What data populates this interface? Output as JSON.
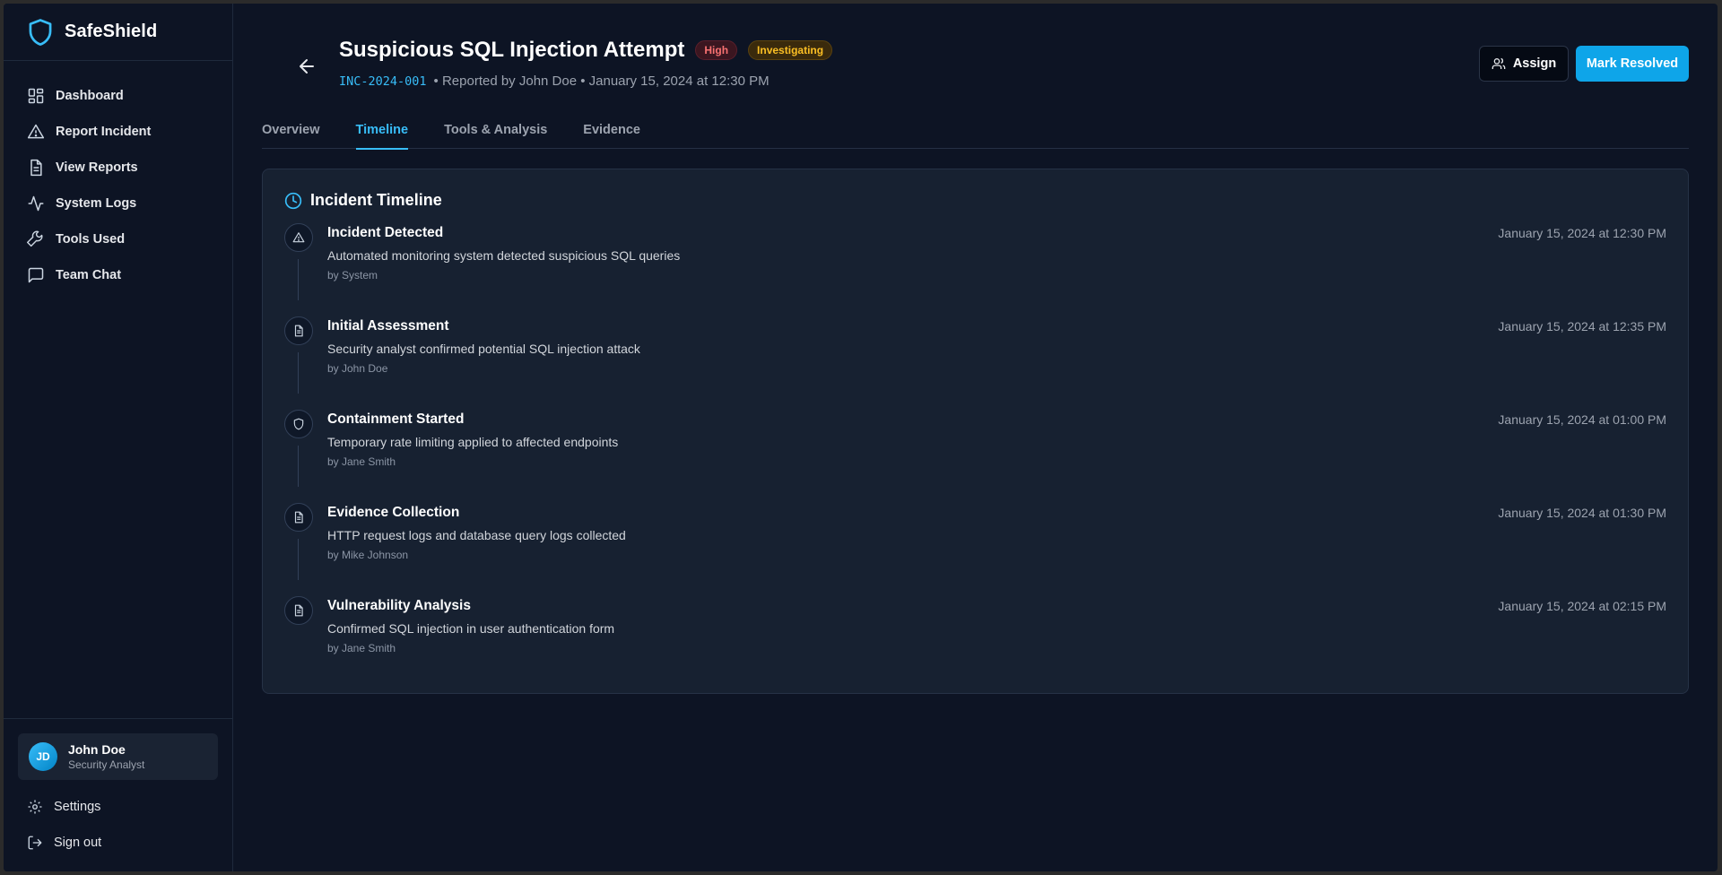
{
  "brand": {
    "name": "SafeShield"
  },
  "nav": [
    {
      "label": "Dashboard",
      "icon": "dashboard-icon"
    },
    {
      "label": "Report Incident",
      "icon": "alert-triangle-icon"
    },
    {
      "label": "View Reports",
      "icon": "file-text-icon"
    },
    {
      "label": "System Logs",
      "icon": "activity-icon"
    },
    {
      "label": "Tools Used",
      "icon": "wrench-icon"
    },
    {
      "label": "Team Chat",
      "icon": "message-square-icon"
    }
  ],
  "user": {
    "initials": "JD",
    "name": "John Doe",
    "role": "Security Analyst"
  },
  "bottom_links": {
    "settings": "Settings",
    "signout": "Sign out"
  },
  "incident": {
    "title": "Suspicious SQL Injection Attempt",
    "severity": "High",
    "status": "Investigating",
    "id": "INC-2024-001",
    "meta": "• Reported by John Doe • January 15, 2024 at 12:30 PM"
  },
  "actions": {
    "assign": "Assign",
    "resolve": "Mark Resolved"
  },
  "tabs": [
    {
      "label": "Overview",
      "active": false
    },
    {
      "label": "Timeline",
      "active": true
    },
    {
      "label": "Tools & Analysis",
      "active": false
    },
    {
      "label": "Evidence",
      "active": false
    }
  ],
  "timeline": {
    "title": "Incident Timeline",
    "events": [
      {
        "icon": "alert-triangle-icon",
        "title": "Incident Detected",
        "description": "Automated monitoring system detected suspicious SQL queries",
        "by": "by System",
        "time": "January 15, 2024 at 12:30 PM"
      },
      {
        "icon": "file-text-icon",
        "title": "Initial Assessment",
        "description": "Security analyst confirmed potential SQL injection attack",
        "by": "by John Doe",
        "time": "January 15, 2024 at 12:35 PM"
      },
      {
        "icon": "shield-icon",
        "title": "Containment Started",
        "description": "Temporary rate limiting applied to affected endpoints",
        "by": "by Jane Smith",
        "time": "January 15, 2024 at 01:00 PM"
      },
      {
        "icon": "file-text-icon",
        "title": "Evidence Collection",
        "description": "HTTP request logs and database query logs collected",
        "by": "by Mike Johnson",
        "time": "January 15, 2024 at 01:30 PM"
      },
      {
        "icon": "file-text-icon",
        "title": "Vulnerability Analysis",
        "description": "Confirmed SQL injection in user authentication form",
        "by": "by Jane Smith",
        "time": "January 15, 2024 at 02:15 PM"
      }
    ]
  },
  "colors": {
    "accent": "#38bdf8",
    "background": "#0d1424",
    "card": "#172131",
    "high": "#f87171",
    "investigating": "#fbbf24"
  }
}
